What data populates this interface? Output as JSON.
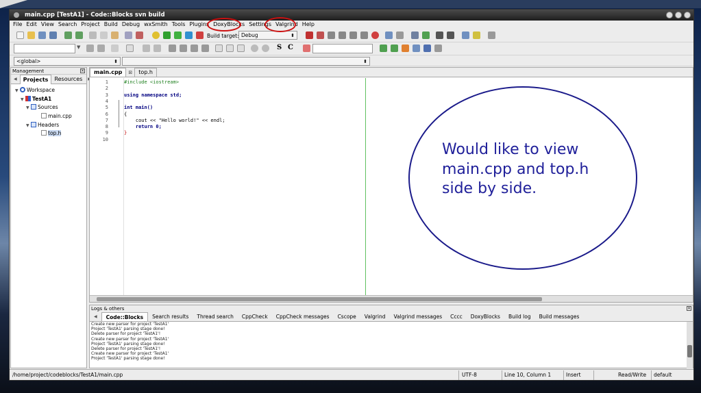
{
  "window": {
    "title": "main.cpp [TestA1] - Code::Blocks svn build"
  },
  "menu": [
    "File",
    "Edit",
    "View",
    "Search",
    "Project",
    "Build",
    "Debug",
    "wxSmith",
    "Tools",
    "Plugins",
    "DoxyBlocks",
    "Settings",
    "Valgrind",
    "Help"
  ],
  "toolbar": {
    "build_target_label": "Build target:",
    "build_target_value": "Debug",
    "scope_value": "<global>"
  },
  "management": {
    "title": "Management",
    "tabs": [
      "Projects",
      "Resources"
    ],
    "tree": {
      "workspace": "Workspace",
      "project": "TestA1",
      "sources": "Sources",
      "source_file": "main.cpp",
      "headers": "Headers",
      "header_file": "top.h"
    }
  },
  "editor": {
    "tabs": [
      "main.cpp",
      "top.h"
    ],
    "line_numbers": [
      "1",
      "2",
      "3",
      "4",
      "5",
      "6",
      "7",
      "8",
      "9",
      "10"
    ],
    "lines": [
      {
        "text": "#include <iostream>",
        "color": "#208020"
      },
      {
        "text": "",
        "color": "#000000"
      },
      {
        "text": "using namespace std;",
        "color": "#000080"
      },
      {
        "text": "",
        "color": "#000000"
      },
      {
        "text": "int main()",
        "color": "#000080"
      },
      {
        "text": "{",
        "color": "#000000"
      },
      {
        "text": "    cout << \"Hello world!\" << endl;",
        "color": "#000000"
      },
      {
        "text": "    return 0;",
        "color": "#000080"
      },
      {
        "text": "}",
        "color": "#c00000"
      },
      {
        "text": "",
        "color": "#000000"
      }
    ]
  },
  "annotation": {
    "text": "Would like to view\nmain.cpp and top.h\nside by side."
  },
  "logs": {
    "title": "Logs & others",
    "tabs": [
      "Code::Blocks",
      "Search results",
      "Thread search",
      "CppCheck",
      "CppCheck messages",
      "Cscope",
      "Valgrind",
      "Valgrind messages",
      "Cccc",
      "DoxyBlocks",
      "Build log",
      "Build messages"
    ],
    "lines": [
      "Create new parser for project 'TestA1'",
      "Project 'TestA1' parsing stage done!",
      "Delete parser for project 'TestA1'!",
      "Create new parser for project 'TestA1'",
      "Project 'TestA1' parsing stage done!",
      "Delete parser for project 'TestA1'!",
      "Create new parser for project 'TestA1'",
      "Project 'TestA1' parsing stage done!"
    ]
  },
  "status": {
    "path": "/home/project/codeblocks/TestA1/main.cpp",
    "encoding": "UTF-8",
    "position": "Line 10, Column 1",
    "mode": "Insert",
    "access": "Read/Write",
    "theme": "default"
  },
  "colors": {
    "circle_red": "#cc1010",
    "annotation_blue": "#20209a",
    "edge_line": "#60c060"
  }
}
